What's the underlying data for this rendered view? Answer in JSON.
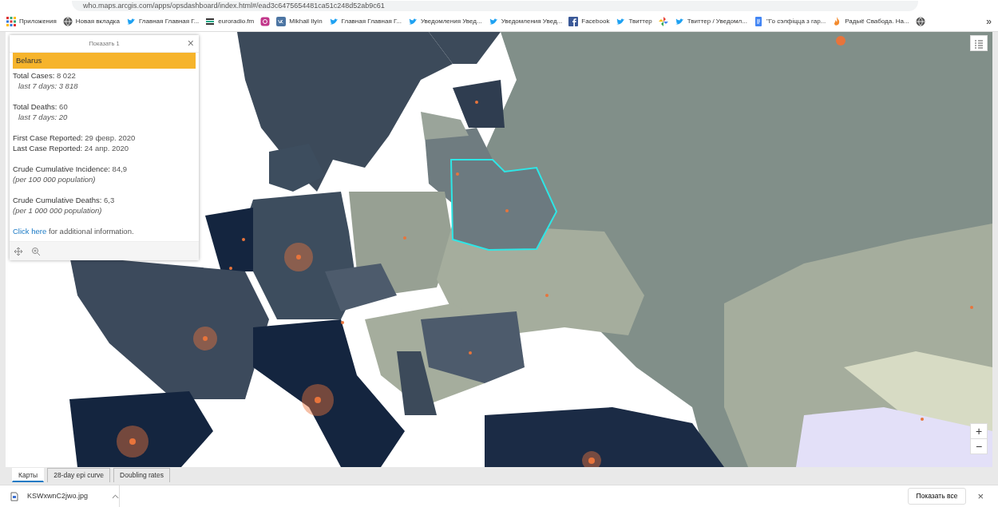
{
  "browser": {
    "url": "who.maps.arcgis.com/apps/opsdashboard/index.html#/ead3c6475654481ca51c248d52ab9c61",
    "bookmarks": [
      {
        "kind": "grid",
        "label": "Приложения"
      },
      {
        "kind": "globe",
        "label": "Новая вкладка"
      },
      {
        "kind": "bird",
        "label": "Главная Главная Г..."
      },
      {
        "kind": "bars",
        "label": "euroradio.fm"
      },
      {
        "kind": "camera"
      },
      {
        "kind": "vk",
        "label": "Mikhail Ilyin"
      },
      {
        "kind": "bird",
        "label": "Главная Главная Г..."
      },
      {
        "kind": "bird",
        "label": "Уведомления Увед..."
      },
      {
        "kind": "bird",
        "label": "Уведомления Увед..."
      },
      {
        "kind": "fb",
        "label": "Facebook"
      },
      {
        "kind": "bird",
        "label": "Твиттер"
      },
      {
        "kind": "pinwheel"
      },
      {
        "kind": "bird",
        "label": "Твиттер / Уведомл..."
      },
      {
        "kind": "doc",
        "label": "\"Го сэлфіцца з гар..."
      },
      {
        "kind": "flame",
        "label": "Радыё Свабода. На..."
      },
      {
        "kind": "globe"
      }
    ],
    "more": "»"
  },
  "popup": {
    "header": "Показать 1",
    "close": "×",
    "title": "Belarus",
    "sections": [
      {
        "lines": [
          {
            "kind": "stat",
            "label": "Total Cases:",
            "value": "8 022"
          },
          {
            "kind": "note",
            "text": "last 7 days: 3 818"
          }
        ]
      },
      {
        "lines": [
          {
            "kind": "stat",
            "label": "Total Deaths:",
            "value": "60"
          },
          {
            "kind": "note",
            "text": "last 7 days: 20"
          }
        ]
      },
      {
        "lines": [
          {
            "kind": "stat",
            "label": "First Case Reported:",
            "value": "29 февр. 2020"
          },
          {
            "kind": "stat",
            "label": "Last Case Reported:",
            "value": "24 апр. 2020"
          }
        ]
      },
      {
        "lines": [
          {
            "kind": "stat",
            "label": "Crude Cumulative Incidence:",
            "value": "84,9"
          },
          {
            "kind": "unit",
            "text": "(per 100 000 population)"
          }
        ]
      },
      {
        "lines": [
          {
            "kind": "stat",
            "label": "Crude Cumulative Deaths:",
            "value": "6,3"
          },
          {
            "kind": "unit",
            "text": "(per 1 000 000 population)"
          }
        ]
      }
    ],
    "link": {
      "text": "Click here",
      "rest": "for additional information."
    }
  },
  "map_controls": {
    "zoom_in": "+",
    "zoom_out": "−"
  },
  "tabs": [
    {
      "label": "Карты",
      "selected": true
    },
    {
      "label": "28-day epi curve",
      "selected": false
    },
    {
      "label": "Doubling rates",
      "selected": false
    }
  ],
  "download": {
    "file": "KSWxwnC2jwo.jpg",
    "show_all": "Показать все",
    "close": "×"
  }
}
